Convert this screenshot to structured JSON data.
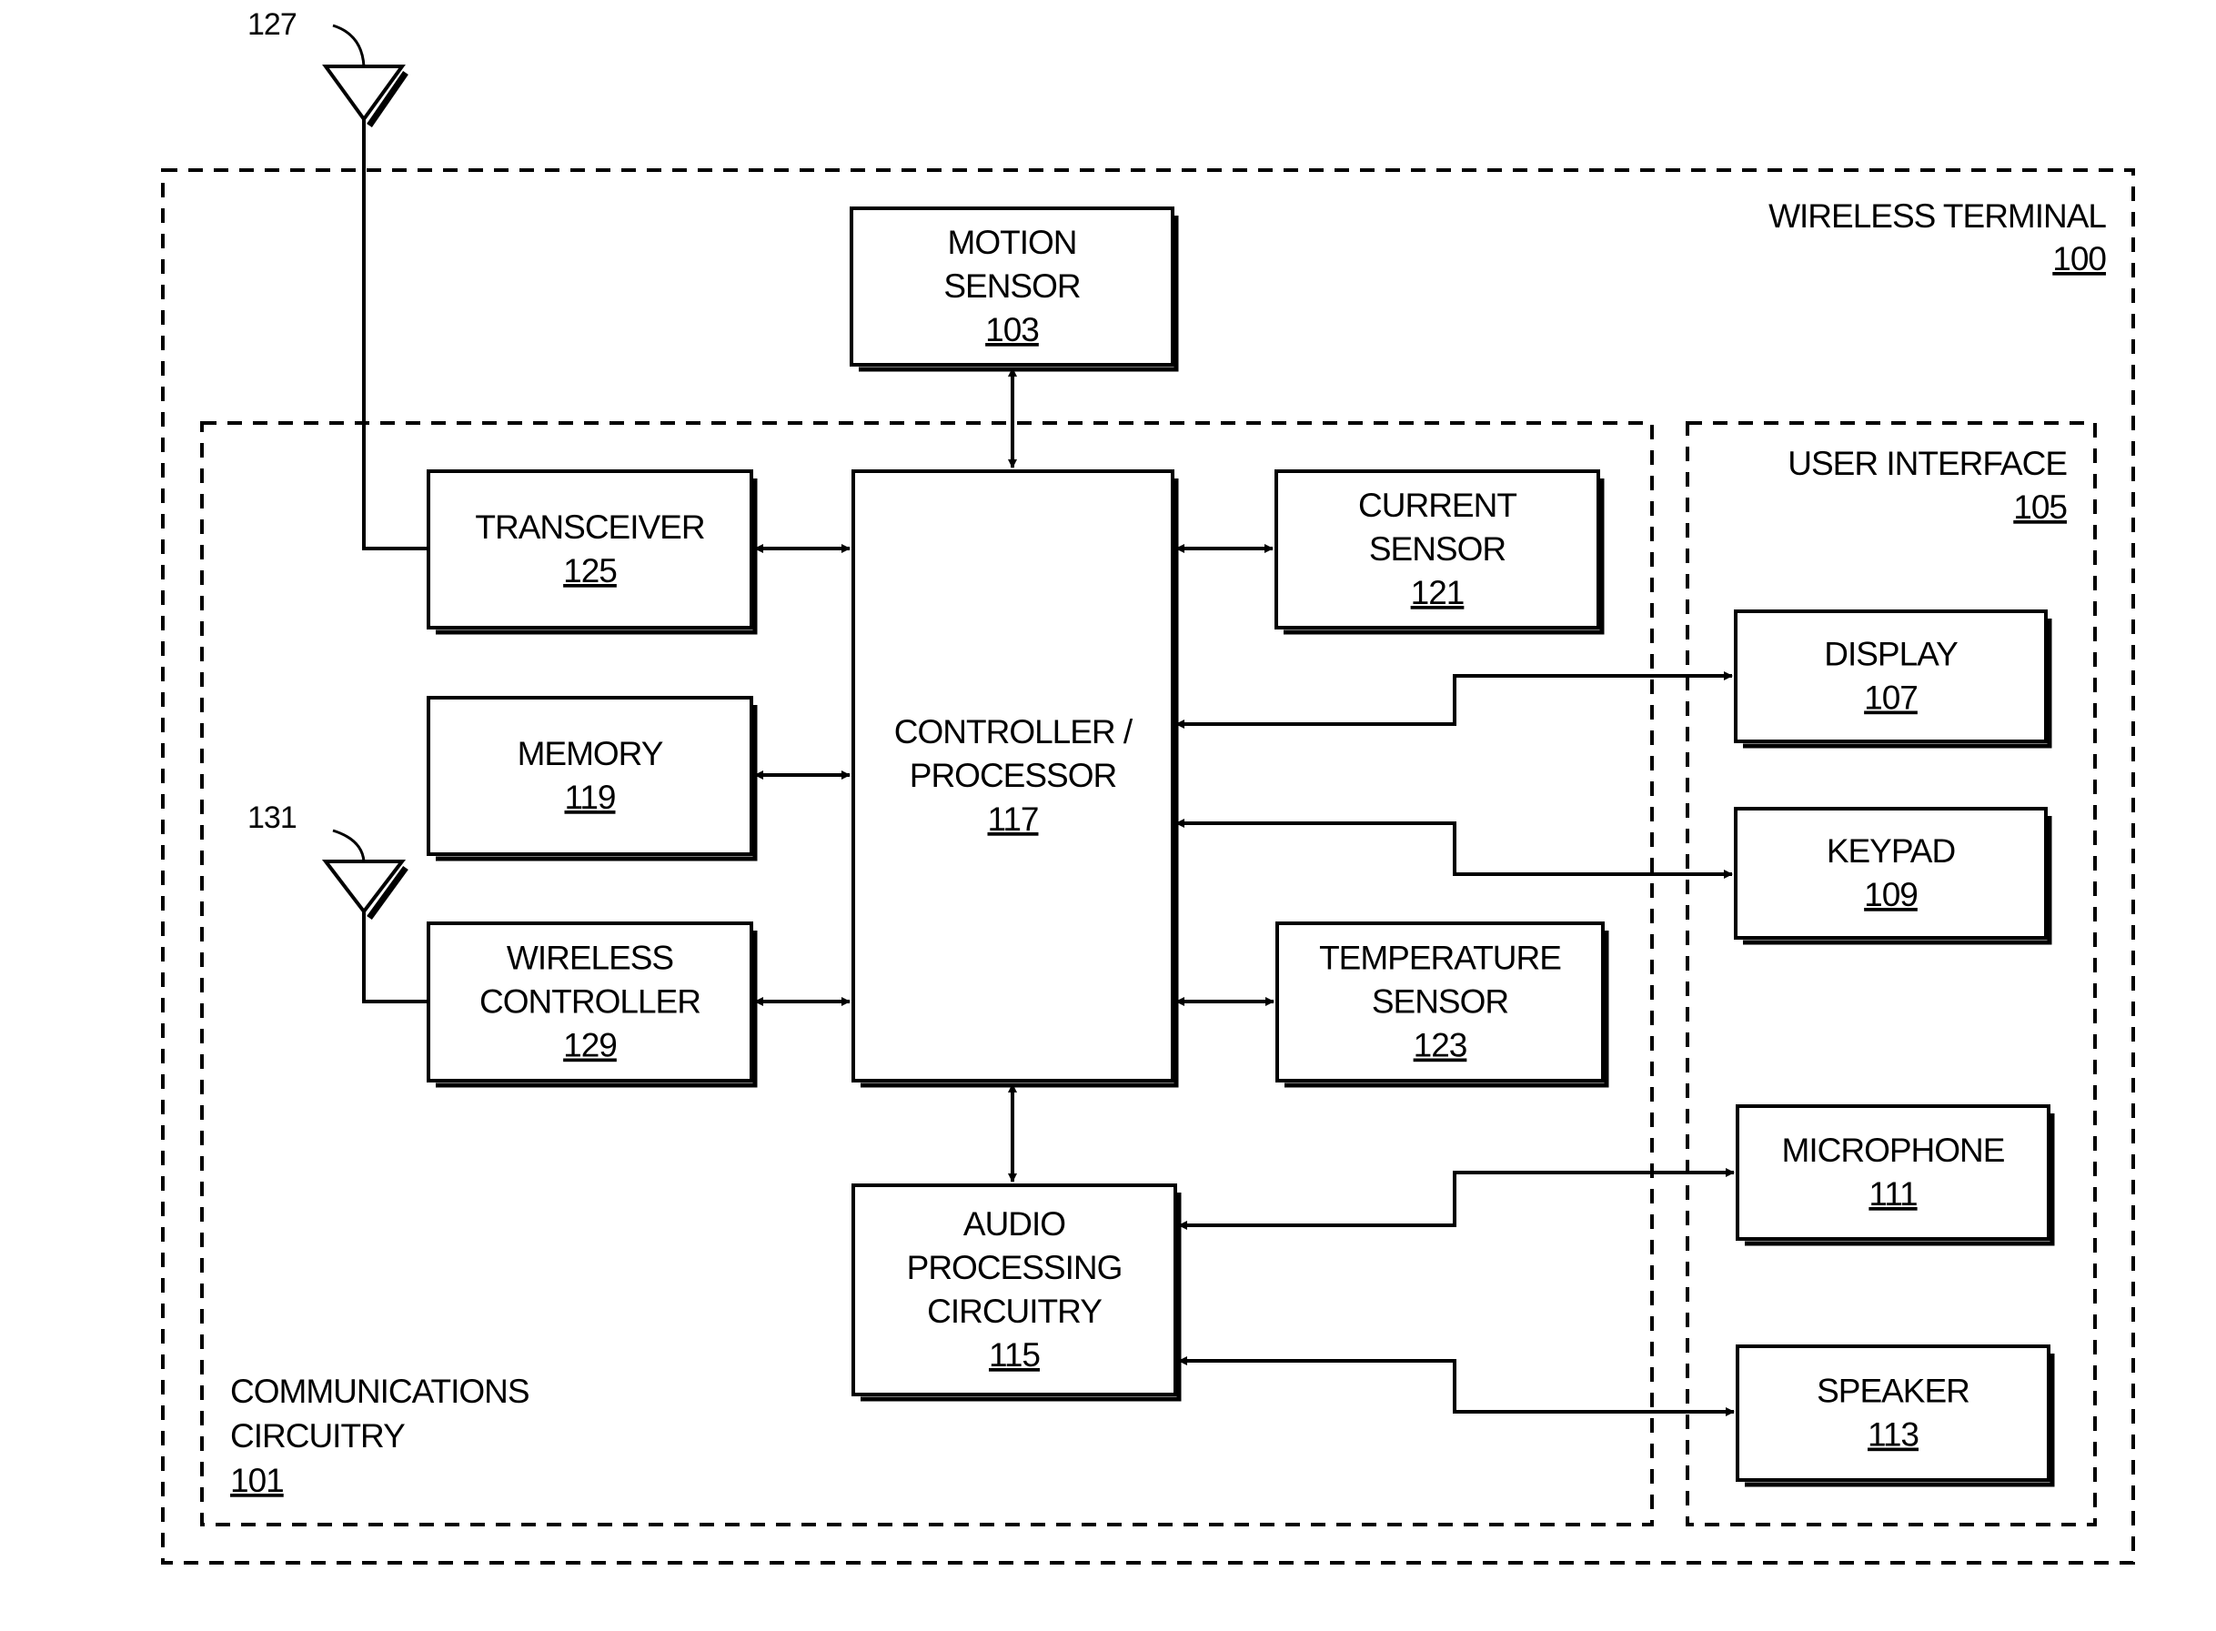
{
  "containers": {
    "wireless_terminal": {
      "label": "WIRELESS TERMINAL",
      "ref": "100"
    },
    "communications_circuitry": {
      "label_line1": "COMMUNICATIONS",
      "label_line2": "CIRCUITRY",
      "ref": "101"
    },
    "user_interface": {
      "label": "USER INTERFACE",
      "ref": "105"
    }
  },
  "blocks": {
    "motion_sensor": {
      "lines": [
        "MOTION",
        "SENSOR"
      ],
      "ref": "103"
    },
    "transceiver": {
      "lines": [
        "TRANSCEIVER"
      ],
      "ref": "125"
    },
    "memory": {
      "lines": [
        "MEMORY"
      ],
      "ref": "119"
    },
    "wireless_controller": {
      "lines": [
        "WIRELESS",
        "CONTROLLER"
      ],
      "ref": "129"
    },
    "controller_processor": {
      "lines": [
        "CONTROLLER /",
        "PROCESSOR"
      ],
      "ref": "117"
    },
    "current_sensor": {
      "lines": [
        "CURRENT",
        "SENSOR"
      ],
      "ref": "121"
    },
    "temperature_sensor": {
      "lines": [
        "TEMPERATURE",
        "SENSOR"
      ],
      "ref": "123"
    },
    "audio_processing": {
      "lines": [
        "AUDIO",
        "PROCESSING",
        "CIRCUITRY"
      ],
      "ref": "115"
    },
    "display": {
      "lines": [
        "DISPLAY"
      ],
      "ref": "107"
    },
    "keypad": {
      "lines": [
        "KEYPAD"
      ],
      "ref": "109"
    },
    "microphone": {
      "lines": [
        "MICROPHONE"
      ],
      "ref": "111"
    },
    "speaker": {
      "lines": [
        "SPEAKER"
      ],
      "ref": "113"
    }
  },
  "antennas": {
    "main": {
      "ref": "127"
    },
    "short_range": {
      "ref": "131"
    }
  },
  "connections": [
    {
      "from": "motion_sensor",
      "to": "controller_processor",
      "direction": "bidirectional"
    },
    {
      "from": "transceiver",
      "to": "controller_processor",
      "direction": "bidirectional"
    },
    {
      "from": "memory",
      "to": "controller_processor",
      "direction": "bidirectional"
    },
    {
      "from": "wireless_controller",
      "to": "controller_processor",
      "direction": "bidirectional"
    },
    {
      "from": "current_sensor",
      "to": "controller_processor",
      "direction": "bidirectional"
    },
    {
      "from": "temperature_sensor",
      "to": "controller_processor",
      "direction": "bidirectional"
    },
    {
      "from": "audio_processing",
      "to": "controller_processor",
      "direction": "bidirectional"
    },
    {
      "from": "display",
      "to": "controller_processor",
      "direction": "bidirectional"
    },
    {
      "from": "keypad",
      "to": "controller_processor",
      "direction": "bidirectional"
    },
    {
      "from": "microphone",
      "to": "audio_processing",
      "direction": "bidirectional"
    },
    {
      "from": "speaker",
      "to": "audio_processing",
      "direction": "bidirectional"
    },
    {
      "from": "antenna_127",
      "to": "transceiver",
      "direction": "line"
    },
    {
      "from": "antenna_131",
      "to": "wireless_controller",
      "direction": "line"
    }
  ]
}
